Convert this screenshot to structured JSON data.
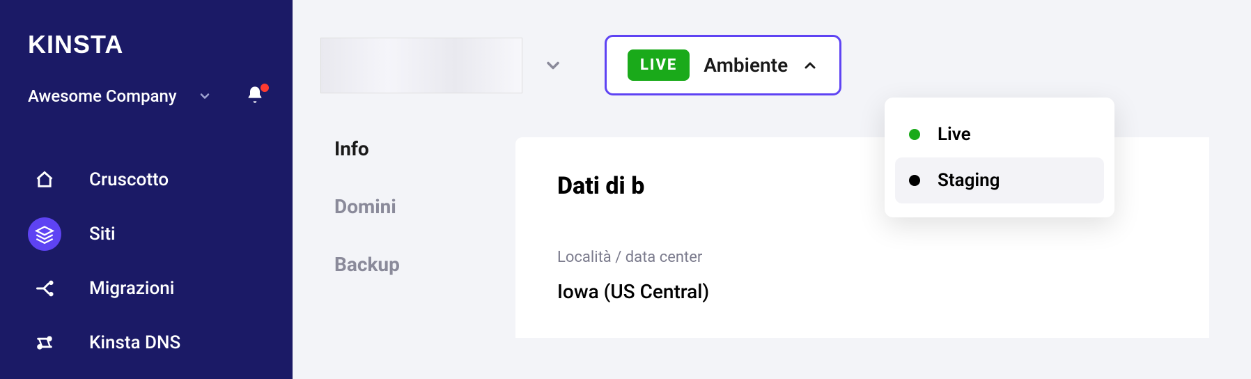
{
  "brand": {
    "logo_text": "KINSTA"
  },
  "company": {
    "name": "Awesome Company"
  },
  "sidebar": {
    "items": [
      {
        "label": "Cruscotto",
        "icon": "home-icon"
      },
      {
        "label": "Siti",
        "icon": "layers-icon"
      },
      {
        "label": "Migrazioni",
        "icon": "arrow-split-icon"
      },
      {
        "label": "Kinsta DNS",
        "icon": "dns-icon"
      }
    ],
    "active_index": 1
  },
  "environment": {
    "badge": "LIVE",
    "label": "Ambiente",
    "options": [
      {
        "label": "Live",
        "color": "green"
      },
      {
        "label": "Staging",
        "color": "black"
      }
    ]
  },
  "subnav": {
    "items": [
      {
        "label": "Info"
      },
      {
        "label": "Domini"
      },
      {
        "label": "Backup"
      }
    ],
    "active_index": 0
  },
  "panel": {
    "heading": "Dati di b",
    "location_label": "Località / data center",
    "location_value": "Iowa (US Central)"
  },
  "colors": {
    "sidebar_bg": "#1b1a66",
    "accent": "#5e43f3",
    "live_green": "#1aaa1a"
  }
}
